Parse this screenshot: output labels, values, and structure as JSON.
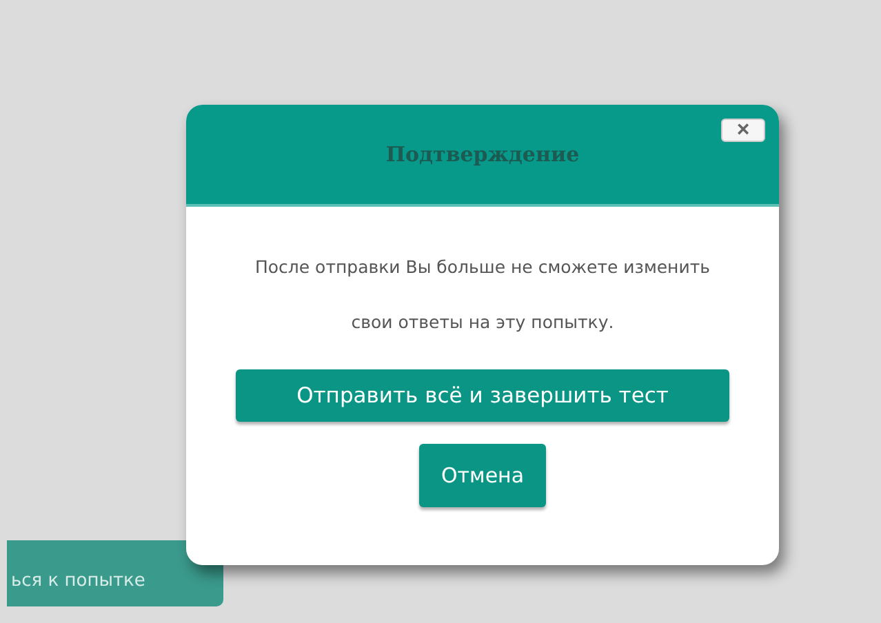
{
  "background_button": {
    "label": "ься к попытке"
  },
  "dialog": {
    "title": "Подтверждение",
    "close": "×",
    "message": "После отправки Вы больше не сможете изменить свои ответы на эту попытку.",
    "buttons": [
      {
        "label": "Отправить всё и завершить тест"
      },
      {
        "label": "Отмена"
      }
    ]
  }
}
